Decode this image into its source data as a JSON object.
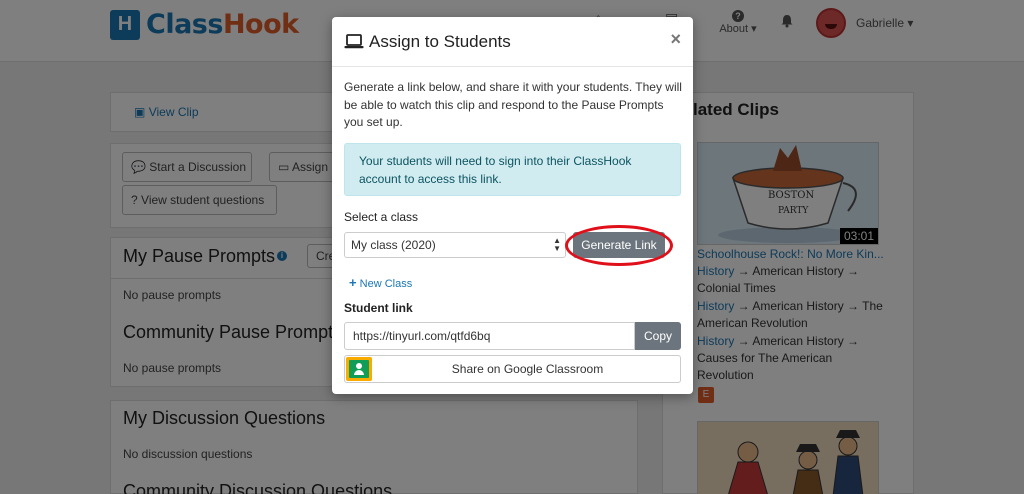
{
  "header": {
    "logo_mark": "H",
    "logo_part1": "Class",
    "logo_part2": "Hook",
    "about_label": "About",
    "user_name": "Gabrielle"
  },
  "main": {
    "view_clip_label": "View Clip",
    "buttons": {
      "start_discussion": "Start a Discussion",
      "assign": "Assign",
      "view_student_questions": "View student questions"
    },
    "sections": [
      {
        "title": "My Pause Prompts",
        "empty": "No pause prompts",
        "action": "Crea"
      },
      {
        "title": "Community Pause Prompts",
        "empty": "No pause prompts"
      },
      {
        "title": "My Discussion Questions",
        "empty": "No discussion questions"
      },
      {
        "title": "Community Discussion Questions"
      }
    ]
  },
  "related": {
    "heading": "lated Clips",
    "clips": [
      {
        "duration": "03:01",
        "title": "Schoolhouse Rock!: No More Kin...",
        "tags": [
          {
            "link": "History",
            "rest": " → American History → Colonial Times"
          },
          {
            "link": "History",
            "rest": " → American History → The American Revolution"
          },
          {
            "link": "History",
            "rest": " → American History → Causes for The American Revolution"
          }
        ],
        "badge": "E"
      }
    ]
  },
  "modal": {
    "title": "Assign to Students",
    "close": "×",
    "description": "Generate a link below, and share it with your students. They will be able to watch this clip and respond to the Pause Prompts you set up.",
    "alert": "Your students will need to sign into their ClassHook account to access this link.",
    "select_label": "Select a class",
    "select_value": "My class (2020)",
    "generate_label": "Generate Link",
    "new_class_label": "New Class",
    "student_link_label": "Student link",
    "student_link_value": "https://tinyurl.com/qtfd6bq",
    "copy_label": "Copy",
    "google_classroom_label": "Share on Google Classroom"
  },
  "colors": {
    "brand_blue": "#1a76b5",
    "brand_orange": "#e05d2b",
    "button_gray": "#6c757d",
    "alert_bg": "#d1ecf1",
    "highlight_red": "#e0101a"
  }
}
